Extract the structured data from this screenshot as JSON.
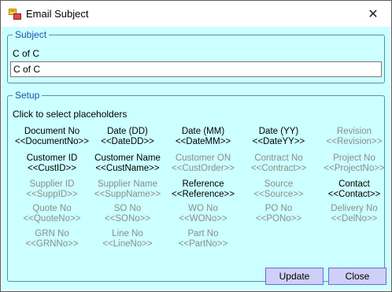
{
  "window": {
    "title": "Email Subject",
    "close_glyph": "✕"
  },
  "subject_group": {
    "legend": "Subject",
    "label": "C of C",
    "input_value": "C of C"
  },
  "setup_group": {
    "legend": "Setup",
    "hint": "Click to select placeholders",
    "placeholders": [
      {
        "name": "Document No",
        "code": "<<DocumentNo>>",
        "enabled": true
      },
      {
        "name": "Date (DD)",
        "code": "<<DateDD>>",
        "enabled": true
      },
      {
        "name": "Date (MM)",
        "code": "<<DateMM>>",
        "enabled": true
      },
      {
        "name": "Date (YY)",
        "code": "<<DateYY>>",
        "enabled": true
      },
      {
        "name": "Revision",
        "code": "<<Revision>>",
        "enabled": false
      },
      {
        "name": "Customer ID",
        "code": "<<CustID>>",
        "enabled": true
      },
      {
        "name": "Customer Name",
        "code": "<<CustName>>",
        "enabled": true
      },
      {
        "name": "Customer ON",
        "code": "<<CustOrder>>",
        "enabled": false
      },
      {
        "name": "Contract No",
        "code": "<<Contract>>",
        "enabled": false
      },
      {
        "name": "Project No",
        "code": "<<ProjectNo>>",
        "enabled": false
      },
      {
        "name": "Supplier ID",
        "code": "<<SuppID>>",
        "enabled": false
      },
      {
        "name": "Supplier Name",
        "code": "<<SuppName>>",
        "enabled": false
      },
      {
        "name": "Reference",
        "code": "<<Reference>>",
        "enabled": true
      },
      {
        "name": "Source",
        "code": "<<Source>>",
        "enabled": false
      },
      {
        "name": "Contact",
        "code": "<<Contact>>",
        "enabled": true
      },
      {
        "name": "Quote No",
        "code": "<<QuoteNo>>",
        "enabled": false
      },
      {
        "name": "SO No",
        "code": "<<SONo>>",
        "enabled": false
      },
      {
        "name": "WO No",
        "code": "<<WONo>>",
        "enabled": false
      },
      {
        "name": "PO No",
        "code": "<<PONo>>",
        "enabled": false
      },
      {
        "name": "Delivery No",
        "code": "<<DelNo>>",
        "enabled": false
      },
      {
        "name": "GRN No",
        "code": "<<GRNNo>>",
        "enabled": false
      },
      {
        "name": "Line No",
        "code": "<<LineNo>>",
        "enabled": false
      },
      {
        "name": "Part No",
        "code": "<<PartNo>>",
        "enabled": false
      }
    ]
  },
  "buttons": {
    "update_label": "Update",
    "close_label": "Close"
  },
  "colors": {
    "client_bg": "#ccffff",
    "legend_text": "#1a56a8",
    "disabled_text": "#8c8c8c",
    "button_bg": "#cfcff7",
    "button_border": "#6b6bd8"
  },
  "icons": {
    "app": "app-window-icon",
    "close": "close-icon"
  }
}
